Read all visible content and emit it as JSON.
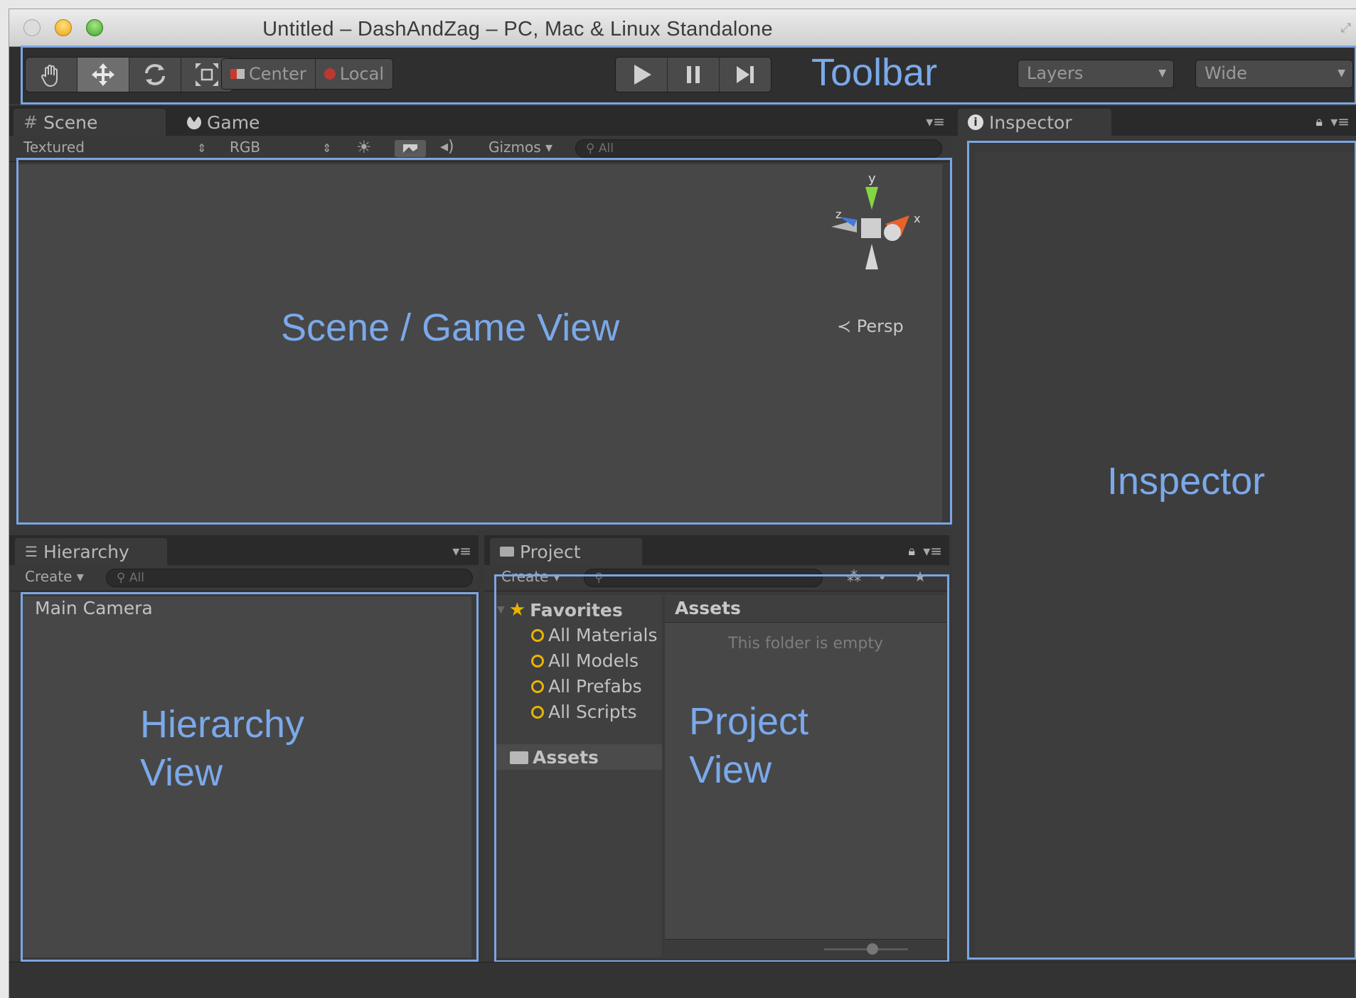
{
  "window": {
    "title": "Untitled – DashAndZag – PC, Mac & Linux Standalone"
  },
  "toolbar": {
    "tools": [
      {
        "name": "hand",
        "icon": "hand-icon"
      },
      {
        "name": "move",
        "icon": "move-icon"
      },
      {
        "name": "rotate",
        "icon": "rotate-icon"
      },
      {
        "name": "scale",
        "icon": "scale-icon"
      }
    ],
    "pivot_center_label": "Center",
    "pivot_local_label": "Local",
    "layers_label": "Layers",
    "layout_label": "Wide"
  },
  "scene_panel": {
    "tabs": [
      "Scene",
      "Game"
    ],
    "render_mode": "Textured",
    "color_mode": "RGB",
    "gizmos_label": "Gizmos",
    "search_placeholder": "All",
    "persp_label": "Persp",
    "axes": {
      "x": "x",
      "y": "y",
      "z": "z"
    }
  },
  "inspector_panel": {
    "tab": "Inspector"
  },
  "hierarchy_panel": {
    "tab": "Hierarchy",
    "create_label": "Create",
    "search_placeholder": "All",
    "items": [
      "Main Camera"
    ]
  },
  "project_panel": {
    "tab": "Project",
    "create_label": "Create",
    "favorites_label": "Favorites",
    "favorites": [
      "All Materials",
      "All Models",
      "All Prefabs",
      "All Scripts"
    ],
    "assets_tree_label": "Assets",
    "assets_header": "Assets",
    "empty_text": "This folder is empty"
  },
  "annotations": {
    "toolbar": "Toolbar",
    "scene": "Scene / Game View",
    "inspector": "Inspector",
    "hierarchy_line1": "Hierarchy",
    "hierarchy_line2": "View",
    "project_line1": "Project",
    "project_line2": "View"
  },
  "colors": {
    "annotation_blue": "#7ba6e4",
    "panel_background": "#474747",
    "favorite_icon": "#e9b400"
  }
}
